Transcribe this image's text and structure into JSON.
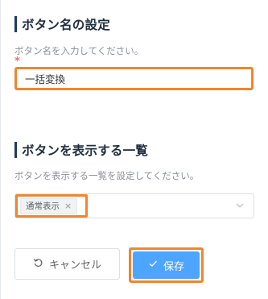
{
  "button_name_section": {
    "heading": "ボタン名の設定",
    "description": "ボタン名を入力してください。",
    "required_mark": "*",
    "input_value": "一括変換"
  },
  "list_section": {
    "heading": "ボタンを表示する一覧",
    "description": "ボタンを表示する一覧を設定してください。",
    "selected_tags": [
      "通常表示"
    ],
    "tag_close": "×"
  },
  "actions": {
    "cancel_label": "キャンセル",
    "save_label": "保存"
  },
  "colors": {
    "accent_primary": "#4ea5ff",
    "highlight_outline": "#f0862f",
    "required": "#f56c6c",
    "heading_bar": "#1f3a63"
  },
  "icons": {
    "cancel": "reset-icon",
    "save": "check-icon",
    "select": "chevron-down-icon",
    "tag_remove": "close-icon"
  }
}
